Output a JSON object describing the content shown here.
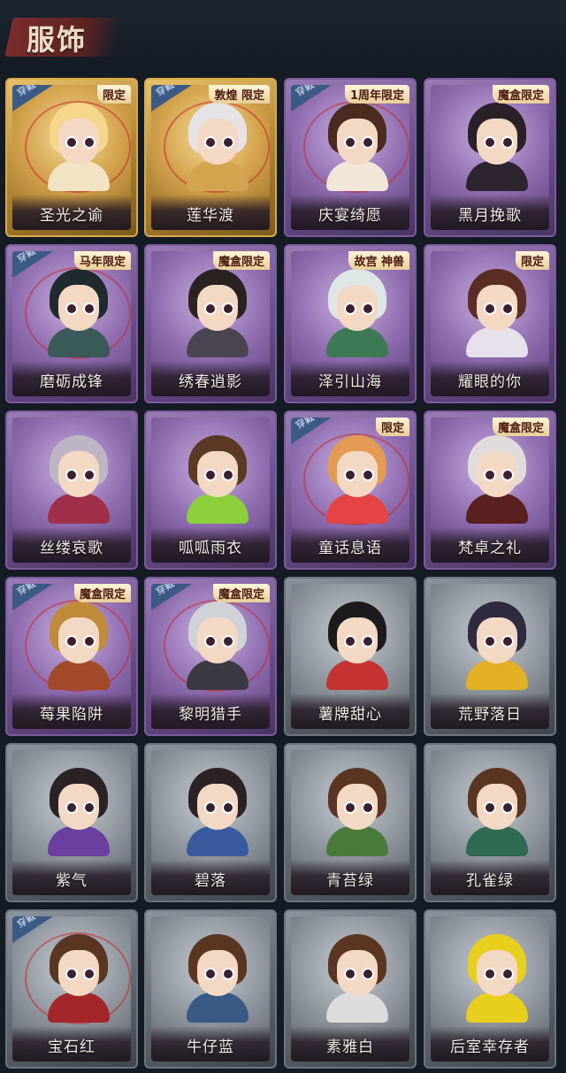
{
  "header": {
    "title": "服饰"
  },
  "colors": {
    "gold": "#d9a94a",
    "purple": "#7c5a9c",
    "gray": "#6d747d",
    "wear": "#3c5a86"
  },
  "cards": [
    {
      "name": "圣光之谕",
      "bg": "gold",
      "wear": "穿戴",
      "badge": "限定",
      "hair": "#f5d68a",
      "outfit": "#f1e3c3",
      "ring": true
    },
    {
      "name": "莲华渡",
      "bg": "gold",
      "wear": "穿戴",
      "badge": "敦煌 限定",
      "hair": "#e6e3e7",
      "outfit": "#d2a44e",
      "ring": true
    },
    {
      "name": "庆宴绮愿",
      "bg": "purple",
      "wear": "穿戴",
      "badge": "1周年限定",
      "hair": "#4b2a20",
      "outfit": "#f2e6d8",
      "ring": true
    },
    {
      "name": "黑月挽歌",
      "bg": "purple",
      "wear": "",
      "badge": "魔盒限定",
      "hair": "#2a2028",
      "outfit": "#2d2430",
      "ring": false
    },
    {
      "name": "磨砺成锋",
      "bg": "purple",
      "wear": "穿戴",
      "badge": "马年限定",
      "hair": "#1f2a2e",
      "outfit": "#3b5a5a",
      "ring": true
    },
    {
      "name": "绣春逍影",
      "bg": "purple",
      "wear": "",
      "badge": "魔盒限定",
      "hair": "#2a2220",
      "outfit": "#4a4550",
      "ring": false
    },
    {
      "name": "泽引山海",
      "bg": "purple",
      "wear": "",
      "badge": "故宫 神兽",
      "hair": "#dfe6e6",
      "outfit": "#3c7a55",
      "ring": false
    },
    {
      "name": "耀眼的你",
      "bg": "purple",
      "wear": "",
      "badge": "限定",
      "hair": "#5a2e25",
      "outfit": "#e6e1ea",
      "ring": false
    },
    {
      "name": "丝缕哀歌",
      "bg": "purple",
      "wear": "",
      "badge": "",
      "hair": "#bdb5c4",
      "outfit": "#a0304a",
      "ring": false
    },
    {
      "name": "呱呱雨衣",
      "bg": "purple",
      "wear": "",
      "badge": "",
      "hair": "#5a3a24",
      "outfit": "#8ccf3c",
      "ring": false
    },
    {
      "name": "童话息语",
      "bg": "purple",
      "wear": "穿戴",
      "badge": "限定",
      "hair": "#e49a52",
      "outfit": "#e44444",
      "ring": true
    },
    {
      "name": "梵卓之礼",
      "bg": "purple",
      "wear": "",
      "badge": "魔盒限定",
      "hair": "#e0dcdc",
      "outfit": "#5a2020",
      "ring": false
    },
    {
      "name": "莓果陷阱",
      "bg": "purple",
      "wear": "穿戴",
      "badge": "魔盒限定",
      "hair": "#c08a3a",
      "outfit": "#a34a2a",
      "ring": true
    },
    {
      "name": "黎明猎手",
      "bg": "purple",
      "wear": "穿戴",
      "badge": "魔盒限定",
      "hair": "#cfd3d8",
      "outfit": "#3a3a42",
      "ring": true
    },
    {
      "name": "薯牌甜心",
      "bg": "gray",
      "wear": "",
      "badge": "",
      "hair": "#1c1a1c",
      "outfit": "#c63333",
      "ring": false
    },
    {
      "name": "荒野落日",
      "bg": "gray",
      "wear": "",
      "badge": "",
      "hair": "#2e2a40",
      "outfit": "#e2b022",
      "ring": false
    },
    {
      "name": "紫气",
      "bg": "gray",
      "wear": "",
      "badge": "",
      "hair": "#2a2224",
      "outfit": "#6a3fa0",
      "ring": false
    },
    {
      "name": "碧落",
      "bg": "gray",
      "wear": "",
      "badge": "",
      "hair": "#2a2224",
      "outfit": "#3a5aa0",
      "ring": false
    },
    {
      "name": "青苔绿",
      "bg": "gray",
      "wear": "",
      "badge": "",
      "hair": "#5a3622",
      "outfit": "#4a7a3a",
      "ring": false
    },
    {
      "name": "孔雀绿",
      "bg": "gray",
      "wear": "",
      "badge": "",
      "hair": "#5a3622",
      "outfit": "#2f6a52",
      "ring": false
    },
    {
      "name": "宝石红",
      "bg": "gray",
      "wear": "穿戴",
      "badge": "",
      "hair": "#5a3622",
      "outfit": "#a3262a",
      "ring": true
    },
    {
      "name": "牛仔蓝",
      "bg": "gray",
      "wear": "",
      "badge": "",
      "hair": "#5a3622",
      "outfit": "#3a5a86",
      "ring": false
    },
    {
      "name": "素雅白",
      "bg": "gray",
      "wear": "",
      "badge": "",
      "hair": "#5a3622",
      "outfit": "#dcdcdc",
      "ring": false
    },
    {
      "name": "后室幸存者",
      "bg": "gray",
      "wear": "",
      "badge": "",
      "hair": "#e8cf1e",
      "outfit": "#e8cf1e",
      "ring": false
    }
  ]
}
